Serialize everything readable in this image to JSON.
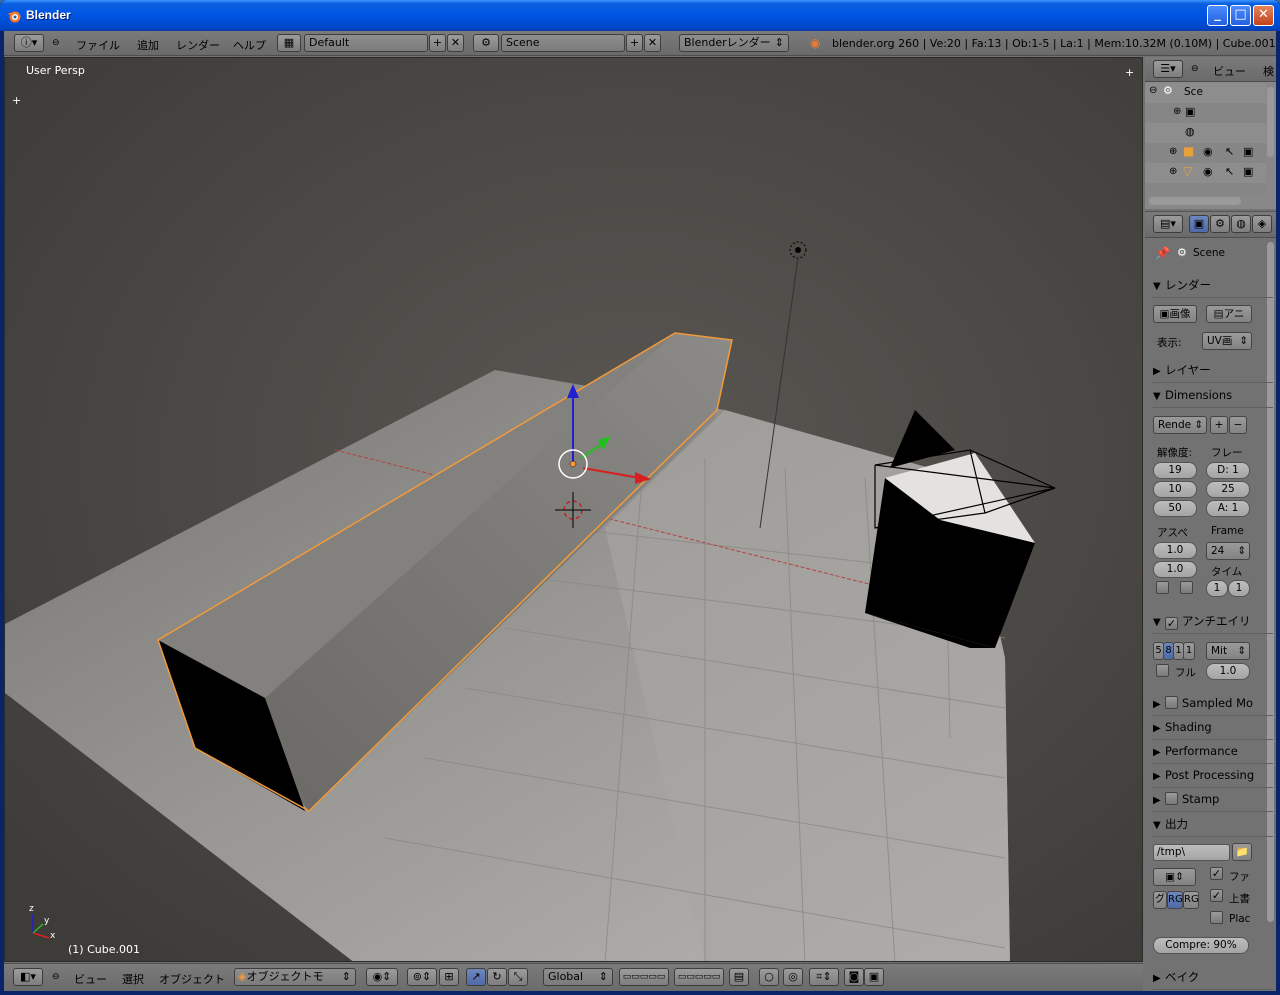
{
  "window": {
    "title": "Blender",
    "min_glyph": "_",
    "max_glyph": "□",
    "close_glyph": "✕"
  },
  "info_header": {
    "menus": [
      "ファイル",
      "追加",
      "レンダー",
      "ヘルプ"
    ],
    "layout_name": "Default",
    "scene_name": "Scene",
    "render_engine": "Blenderレンダー",
    "stats": "blender.org 260 | Ve:20 | Fa:13 | Ob:1-5 | La:1 | Mem:10.32M (0.10M) | Cube.001"
  },
  "viewport": {
    "view_label": "User Persp",
    "object_label": "(1) Cube.001",
    "axis_y": "y",
    "axis_x": "x",
    "axis_z": "z"
  },
  "view3d_header": {
    "menus": [
      "ビュー",
      "選択",
      "オブジェクト"
    ],
    "mode": "オブジェクトモ",
    "orientation": "Global"
  },
  "outliner": {
    "header_label": "ビュー",
    "search_label": "検",
    "scene_label": "Sce"
  },
  "properties": {
    "scene_label": "Scene",
    "sections": {
      "render": "レンダー",
      "layers": "レイヤー",
      "dimensions": "Dimensions",
      "antialiasing": "アンチエイリ",
      "sampled_motion": "Sampled Mo",
      "shading": "Shading",
      "performance": "Performance",
      "post_processing": "Post Processing",
      "stamp": "Stamp",
      "output": "出力",
      "bake": "ベイク"
    },
    "render": {
      "image_button": "画像",
      "anim_button": "アニ",
      "display_label": "表示:",
      "display_value": "UV画"
    },
    "dimensions": {
      "preset": "Rende",
      "resolution_label": "解像度:",
      "frame_label": "フレー",
      "res_x": "19",
      "res_y": "10",
      "res_pct": "50",
      "frame_current": "D: 1",
      "frame_end": "25",
      "frame_step": "A: 1",
      "aspect_label": "アスペ",
      "frame_rate_label": "Frame",
      "aspect_x": "1.0",
      "aspect_y": "1.0",
      "fps": "24",
      "time_label": "タイム",
      "time_old": "1",
      "time_new": "1"
    },
    "antialiasing": {
      "samples": [
        "5",
        "8",
        "1",
        "1"
      ],
      "filter": "Mit",
      "full_label": "フル",
      "filter_size": "1.0"
    },
    "output": {
      "path": "/tmp\\",
      "file_ext_label": "ファ",
      "overwrite_label": "上書",
      "placeholders_label": "Plac",
      "color_modes": [
        "グ",
        "RG",
        "RG"
      ],
      "compression": "Compre: 90%"
    }
  },
  "colors": {
    "selection_outline": "#f29a3a",
    "viewport_bg": "#393939",
    "floor": "#8d8b88",
    "axis_x": "#d62020",
    "axis_y": "#20c020",
    "axis_z": "#2020d0",
    "highlight": "#5680c2"
  }
}
